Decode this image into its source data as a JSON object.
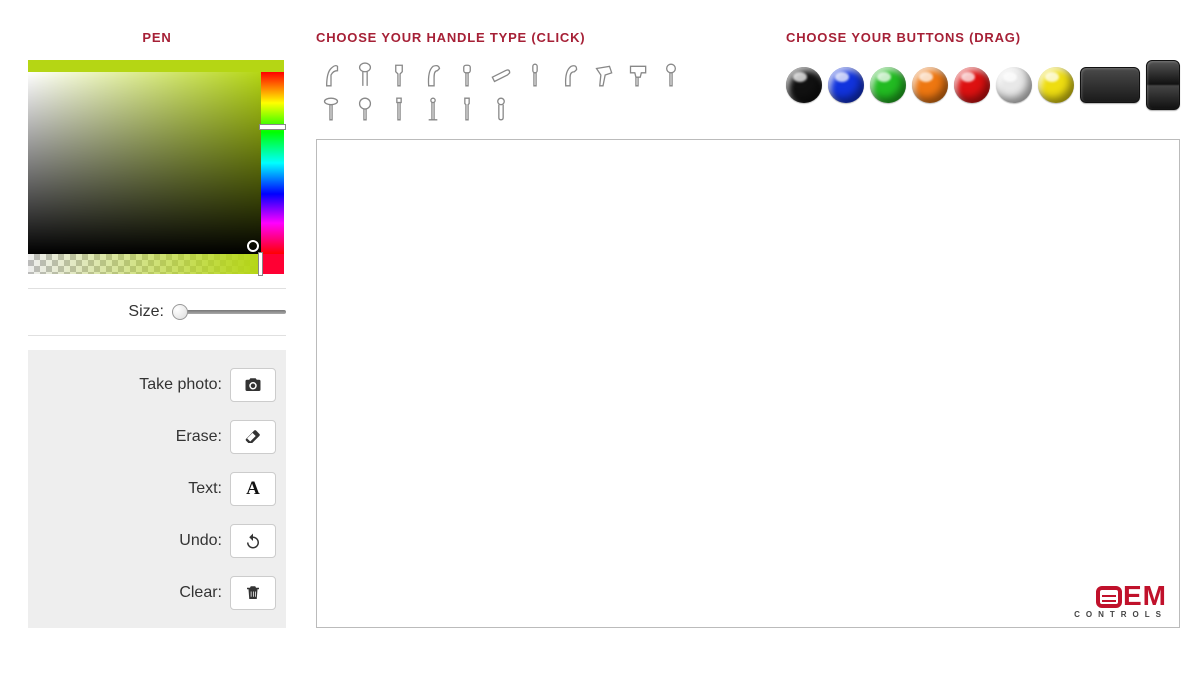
{
  "sidebar": {
    "pen_title": "Pen",
    "size_label": "Size:",
    "tools": {
      "photo_label": "Take photo:",
      "erase_label": "Erase:",
      "text_label": "Text:",
      "undo_label": "Undo:",
      "clear_label": "Clear:"
    }
  },
  "handle": {
    "title": "Choose Your Handle Type (Click)",
    "items": [
      "h1",
      "h2",
      "h3",
      "h4",
      "h5",
      "h6",
      "h7",
      "h8",
      "h9",
      "h10",
      "h11",
      "h12",
      "h13",
      "h14",
      "h15",
      "h16",
      "h17"
    ]
  },
  "buttons": {
    "title": "Choose Your Buttons (Drag)",
    "colors": [
      {
        "name": "black",
        "hex": "#111111"
      },
      {
        "name": "blue",
        "hex": "#1133dd"
      },
      {
        "name": "green",
        "hex": "#22bb22"
      },
      {
        "name": "orange",
        "hex": "#ee7711"
      },
      {
        "name": "red",
        "hex": "#dd1111"
      },
      {
        "name": "white",
        "hex": "#e8e8e8"
      },
      {
        "name": "yellow",
        "hex": "#eedd11"
      }
    ]
  },
  "logo": {
    "main": "EM",
    "sub": "CONTROLS"
  }
}
